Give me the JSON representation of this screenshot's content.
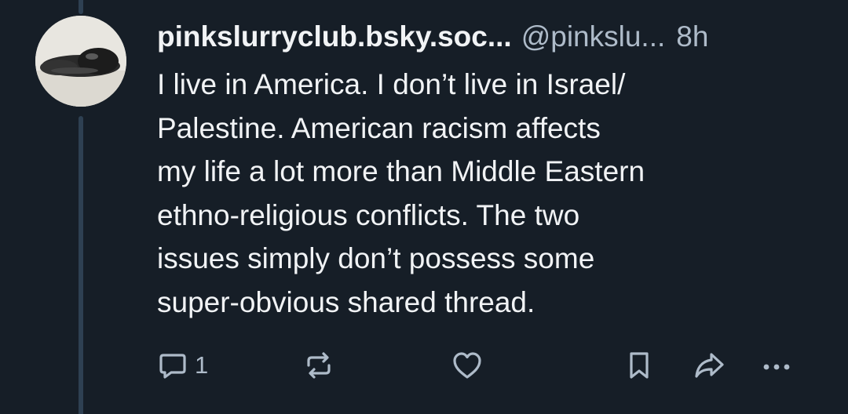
{
  "post": {
    "display_name": "pinkslurryclub.bsky.soc...",
    "handle": "@pinkslu...",
    "separator": " ",
    "time": "8h",
    "text": "I live in America. I don’t live in Israel/\nPalestine. American racism affects\nmy life a lot more than Middle Eastern\nethno-religious conflicts. The two\nissues simply don’t possess some\nsuper-obvious shared thread."
  },
  "actions": {
    "reply_icon": "reply-icon",
    "reply_count": "1",
    "repost_icon": "repost-icon",
    "like_icon": "heart-icon",
    "bookmark_icon": "bookmark-icon",
    "share_icon": "share-icon",
    "more_icon": "more-icon"
  },
  "colors": {
    "background": "#161e27",
    "text": "#f1f3f5",
    "muted": "#aebbc9",
    "thread_line": "#2e4052"
  }
}
